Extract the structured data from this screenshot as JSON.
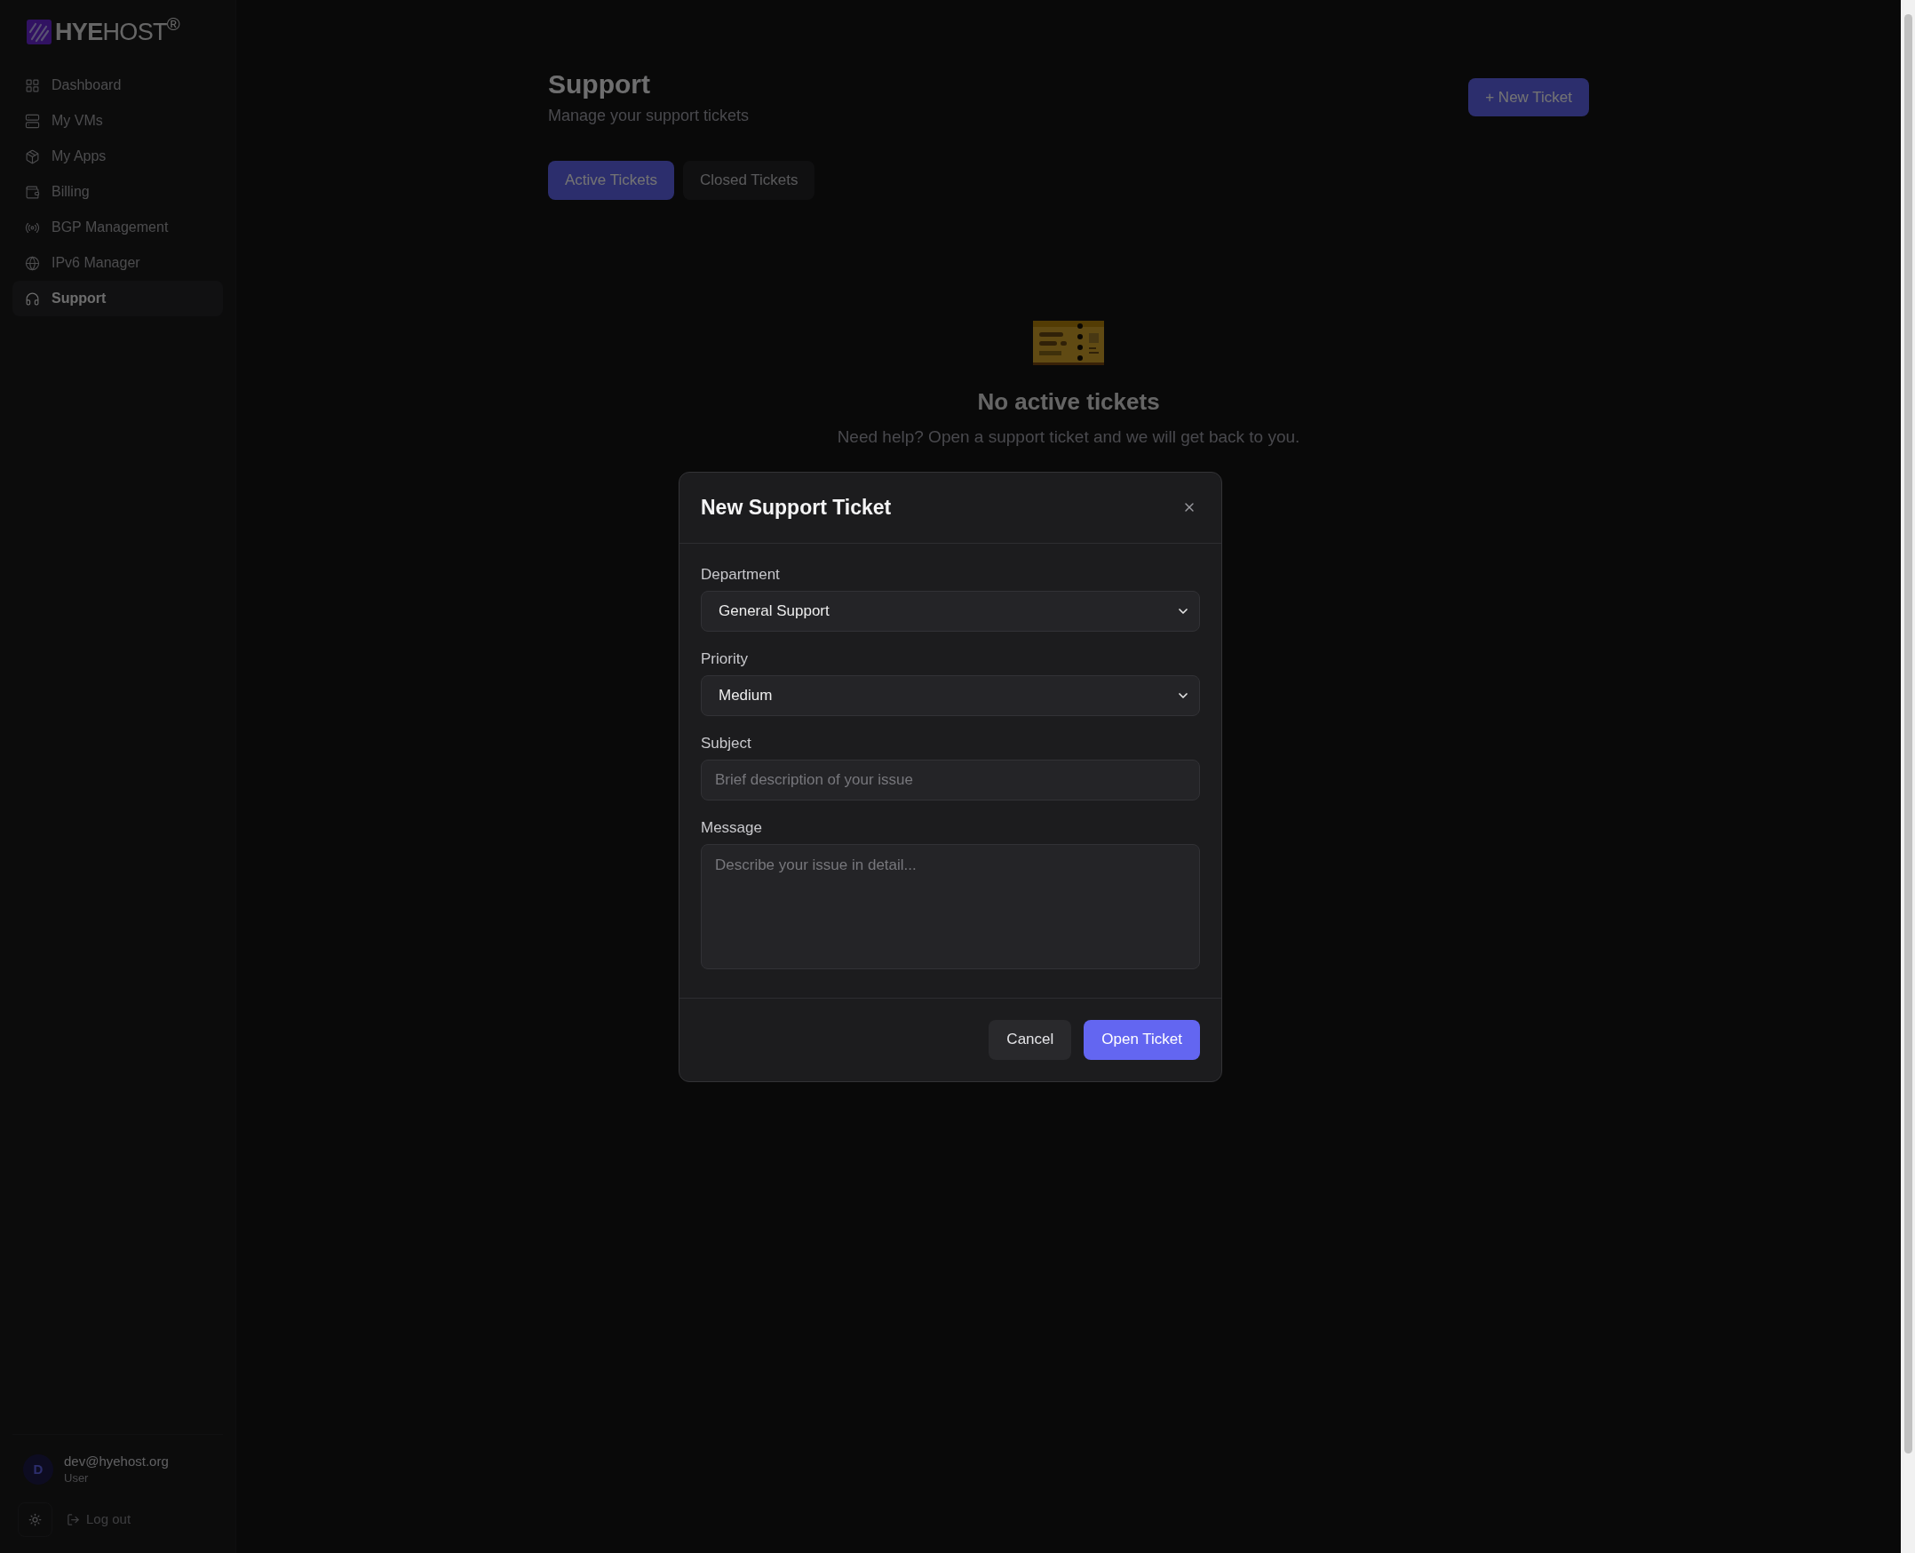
{
  "logo": {
    "text": "**HYE**HOST$^{®}$"
  },
  "sidebar": {
    "items": [
      {
        "label": "Dashboard",
        "selected": false
      },
      {
        "label": "My VMs",
        "selected": false
      },
      {
        "label": "My Apps",
        "selected": false
      },
      {
        "label": "Billing",
        "selected": false
      },
      {
        "label": "BGP Management",
        "selected": false
      },
      {
        "label": "IPv6 Manager",
        "selected": false
      },
      {
        "label": "Support",
        "selected": true
      }
    ]
  },
  "user": {
    "avatar": "D",
    "email": "dev@hyehost.org",
    "role": "User"
  },
  "logout": "Log out",
  "page": {
    "title": "Support",
    "subtitle": "Manage your support tickets",
    "new_button": "+ New Ticket"
  },
  "tabs": [
    {
      "label": "Active Tickets",
      "selected": true
    },
    {
      "label": "Closed Tickets",
      "selected": false
    }
  ],
  "empty_state": {
    "title": "No active tickets",
    "text": "Need help? Open a support ticket and we will get back to you."
  },
  "modal": {
    "title": "New Support Ticket",
    "fields": [
      {
        "kind": "select",
        "label": "Department",
        "value": "General Support"
      },
      {
        "kind": "select",
        "label": "Priority",
        "value": "Medium"
      },
      {
        "kind": "input",
        "label": "Subject",
        "placeholder": "Brief description of your issue"
      },
      {
        "kind": "textarea",
        "label": "Message",
        "placeholder": "Describe your issue in detail..."
      }
    ],
    "buttons": [
      {
        "kind": "secondary",
        "label": "Cancel"
      },
      {
        "kind": "primary",
        "label": "Open Ticket"
      }
    ]
  }
}
